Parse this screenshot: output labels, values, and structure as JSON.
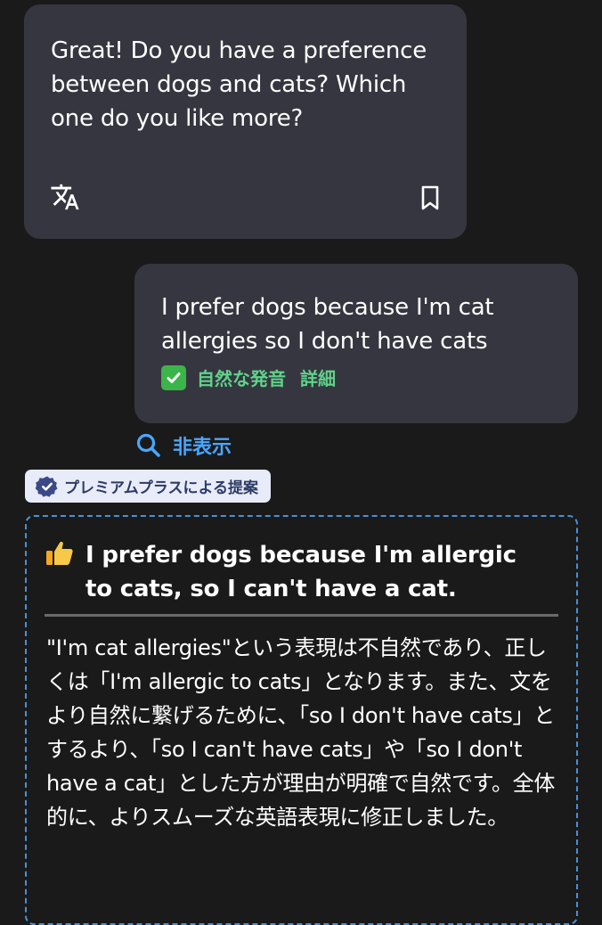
{
  "ai_message": {
    "text": "Great! Do you have a preference between dogs and cats? Which one do you like more?",
    "icons": {
      "translate": "translate-icon",
      "bookmark": "bookmark-icon"
    }
  },
  "user_message": {
    "text": "I prefer dogs because I'm cat allergies so I don't have cats",
    "status_label": "自然な発音",
    "details_link": "詳細"
  },
  "hide_toggle": {
    "label": "非表示"
  },
  "premium_badge": {
    "label": "プレミアムプラスによる提案"
  },
  "suggestion": {
    "corrected_text": "I prefer dogs because I'm allergic to cats, so I can't have a cat.",
    "explanation": "\"I'm cat allergies\"という表現は不自然であり、正しくは「I'm allergic to cats」となります。また、文をより自然に繋げるために、「so I don't have cats」とするより、「so I can't have cats」や「so I don't have a cat」とした方が理由が明確で自然です。全体的に、よりスムーズな英語表現に修正しました。"
  },
  "colors": {
    "background": "#1a1a1a",
    "bubble": "#363640",
    "accent_blue": "#4aa6ff",
    "success_green": "#5fd38a",
    "badge_bg": "#e8ecf8",
    "thumb": "#f5c542"
  }
}
